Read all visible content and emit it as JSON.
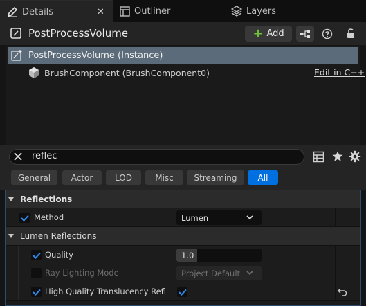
{
  "tabs": {
    "details": "Details",
    "outliner": "Outliner",
    "layers": "Layers",
    "close_glyph": "✕"
  },
  "header": {
    "title": "PostProcessVolume",
    "add_label": "Add"
  },
  "tree": {
    "root": "PostProcessVolume (Instance)",
    "child": "BrushComponent (BrushComponent0)",
    "edit_link": "Edit in C++"
  },
  "search": {
    "value": "reflec"
  },
  "filters": [
    "General",
    "Actor",
    "LOD",
    "Misc",
    "Streaming",
    "All"
  ],
  "filters_active": "All",
  "properties": {
    "section": "Reflections",
    "method_label": "Method",
    "method_value": "Lumen",
    "method_enabled": true,
    "subsection": "Lumen Reflections",
    "quality_label": "Quality",
    "quality_value": "1.0",
    "quality_enabled": true,
    "raylighting_label": "Ray Lighting Mode",
    "raylighting_value": "Project Default",
    "raylighting_enabled": false,
    "hq_label": "High Quality Translucency Reflec...",
    "hq_enabled": true,
    "hq_value_checked": true
  },
  "colors": {
    "accent": "#0070e0",
    "selection": "#5b6b7a",
    "add_plus": "#6fbf3a",
    "checkmark": "#2f8cf0"
  }
}
